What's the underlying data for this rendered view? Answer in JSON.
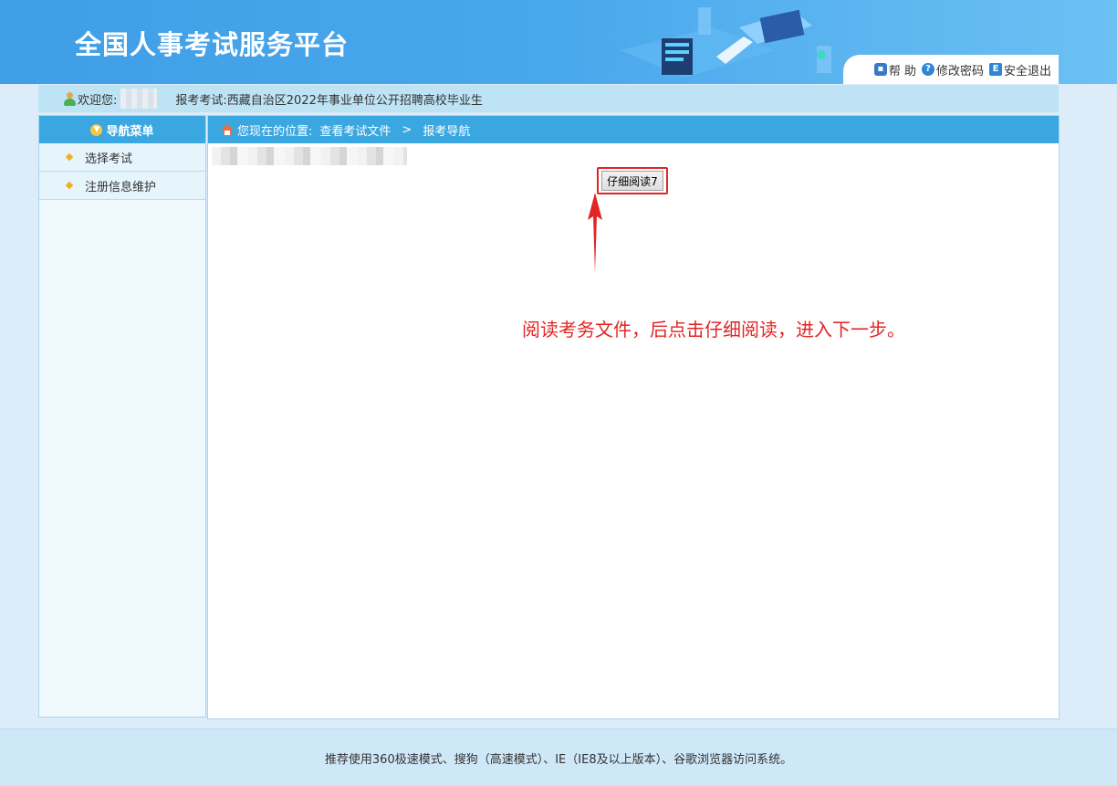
{
  "header": {
    "site_title": "全国人事考试服务平台",
    "links": {
      "help": "帮 助",
      "change_password": "修改密码",
      "logout": "安全退出"
    }
  },
  "infobar": {
    "welcome_label": "欢迎您:",
    "exam_label": "报考考试:",
    "exam_name": "西藏自治区2022年事业单位公开招聘高校毕业生"
  },
  "sidebar": {
    "title": "导航菜单",
    "items": [
      {
        "label": "选择考试"
      },
      {
        "label": "注册信息维护"
      }
    ]
  },
  "breadcrumb": {
    "prefix": "您现在的位置:",
    "path1": "查看考试文件",
    "separator": ">",
    "path2": "报考导航"
  },
  "main": {
    "read_button_label": "仔细阅读7",
    "annotation": "阅读考务文件，后点击仔细阅读，进入下一步。"
  },
  "footer": {
    "text": "推荐使用360极速模式、搜狗（高速模式）、IE（IE8及以上版本）、谷歌浏览器访问系统。"
  },
  "colors": {
    "header_blue": "#3f9ee6",
    "nav_blue": "#3aa7e0",
    "annotation_red": "#e32424"
  }
}
